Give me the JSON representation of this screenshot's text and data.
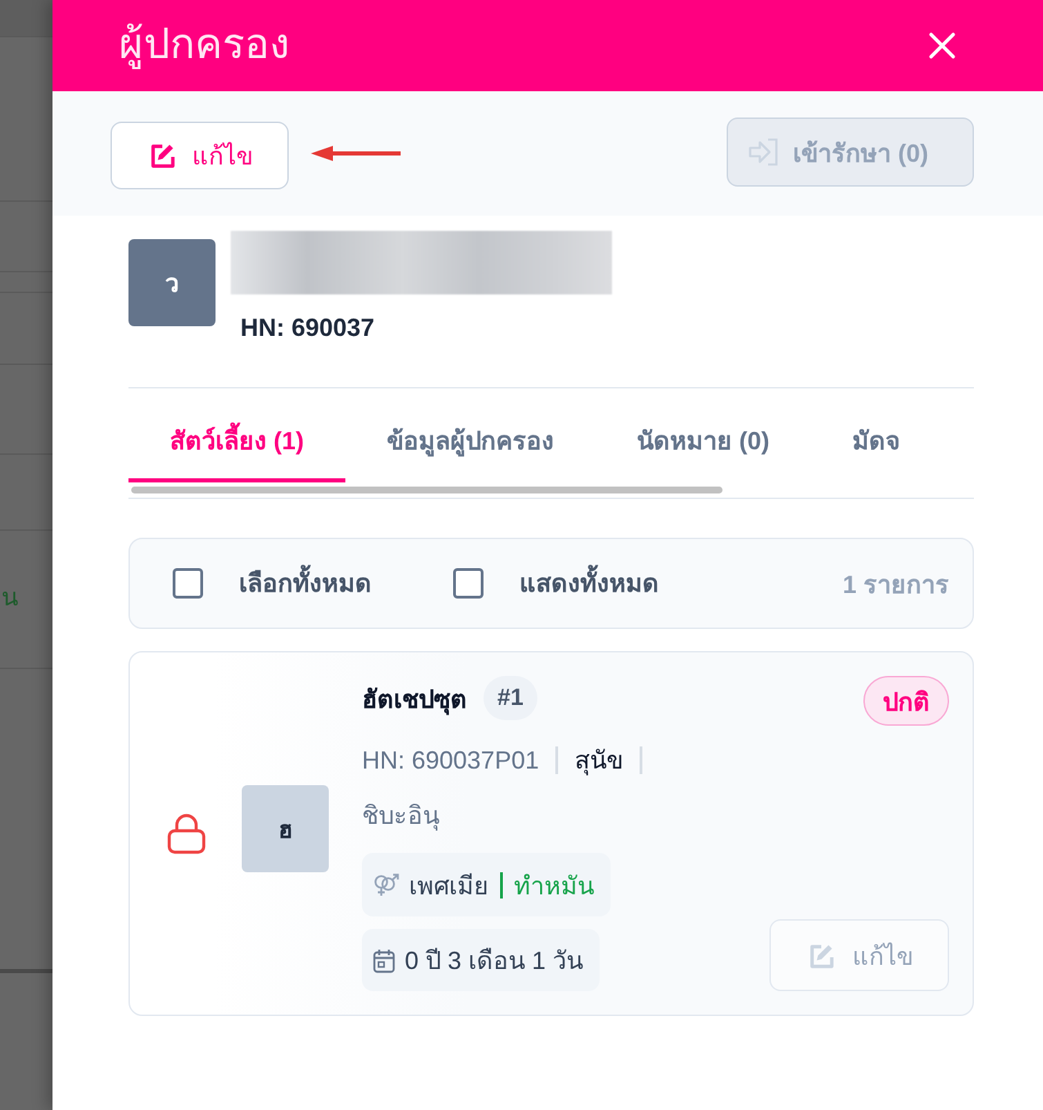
{
  "background_page": {
    "text_fragment": "น"
  },
  "drawer": {
    "title": "ผู้ปกครอง"
  },
  "toolbar": {
    "edit_button": {
      "label": "แก้ไข",
      "disabled": false
    },
    "admit_button": {
      "label": "เข้ารักษา (0)",
      "disabled": true
    }
  },
  "owner": {
    "avatar_initial": "ว",
    "hn": "HN: 690037"
  },
  "tabs": [
    {
      "label": "สัตว์เลี้ยง (1)",
      "selected": true
    },
    {
      "label": "ข้อมูลผู้ปกครอง",
      "selected": false
    },
    {
      "label": "นัดหมาย (0)",
      "selected": false
    },
    {
      "label": "มัดจ",
      "selected": false
    }
  ],
  "select_bar": {
    "select_all": {
      "label": "เลือกทั้งหมด",
      "checked": false
    },
    "show_all": {
      "label": "แสดงทั้งหมด",
      "checked": false
    },
    "count": "1 รายการ"
  },
  "pets": [
    {
      "locked": true,
      "avatar_initial": "ฮ",
      "name": "ฮัตเชปซุต",
      "number": "#1",
      "status": "ปกติ",
      "hn": "HN: 690037P01",
      "species": "สุนัข",
      "breed": "ชิบะอินุ",
      "sex": "เพศเมีย",
      "neutered": "ทำหมัน",
      "age": "0 ปี 3 เดือน 1 วัน",
      "edit_button": {
        "label": "แก้ไข",
        "disabled": true
      }
    }
  ]
}
